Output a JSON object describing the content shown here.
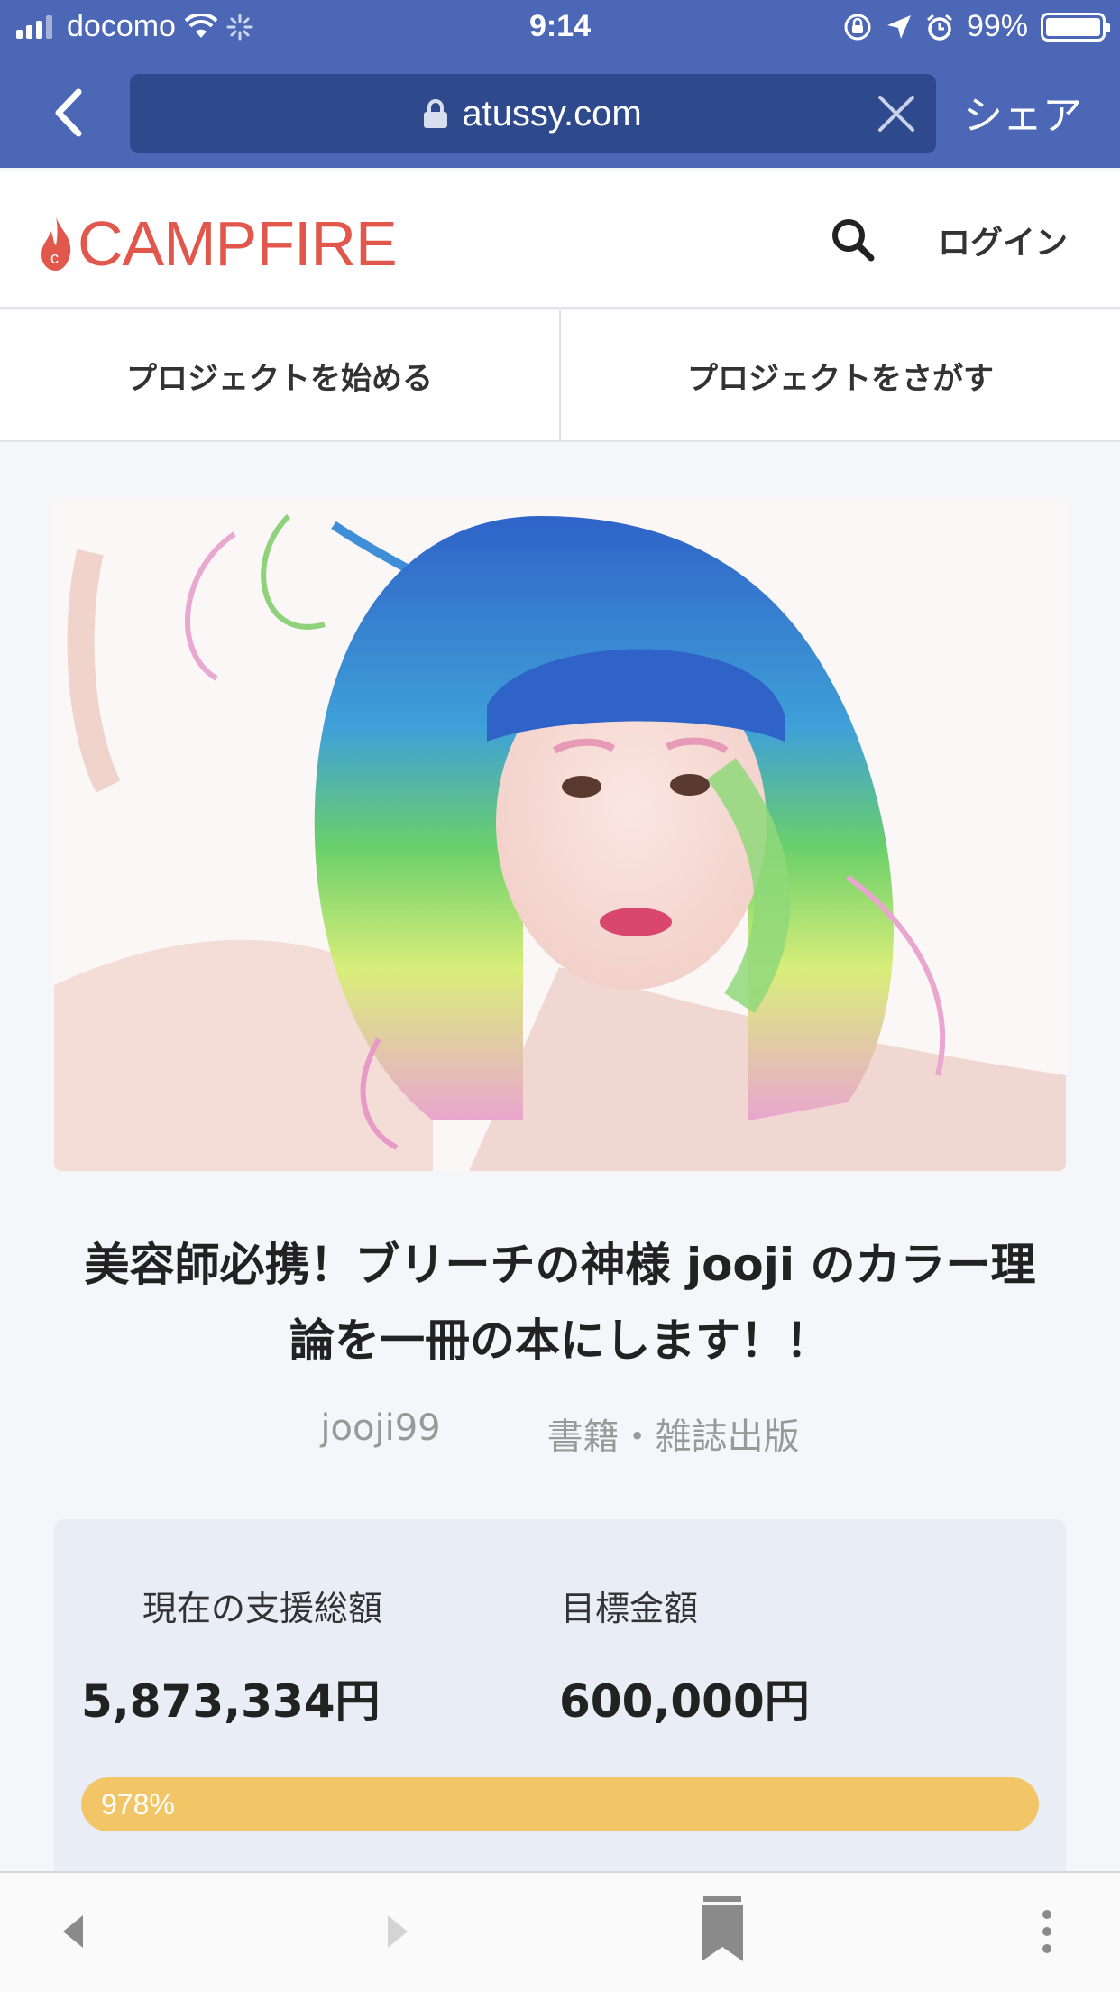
{
  "status_bar": {
    "carrier": "docomo",
    "time": "9:14",
    "battery": "99%"
  },
  "browser": {
    "url": "atussy.com",
    "share_label": "シェア"
  },
  "site": {
    "logo_text": "CAMPFIRE",
    "brand_color": "#e2574c",
    "login_label": "ログイン"
  },
  "tabs": [
    {
      "label": "プロジェクトを始める"
    },
    {
      "label": "プロジェクトをさがす"
    }
  ],
  "project": {
    "title_line1": "美容師必携！ブリーチの神様 jooji のカラー理",
    "title_line2": "論を一冊の本にします！！",
    "owner": "jooji99",
    "category": "書籍・雑誌出版",
    "hero_image": "woman with blue, green, yellow and pink gradient hair"
  },
  "stats": {
    "raised_label": "現在の支援総額",
    "raised_value": "5,873,334円",
    "goal_label": "目標金額",
    "goal_value": "600,000円",
    "progress_label": "978%",
    "progress_fraction": 1.0,
    "progress_color": "#f2c666"
  }
}
